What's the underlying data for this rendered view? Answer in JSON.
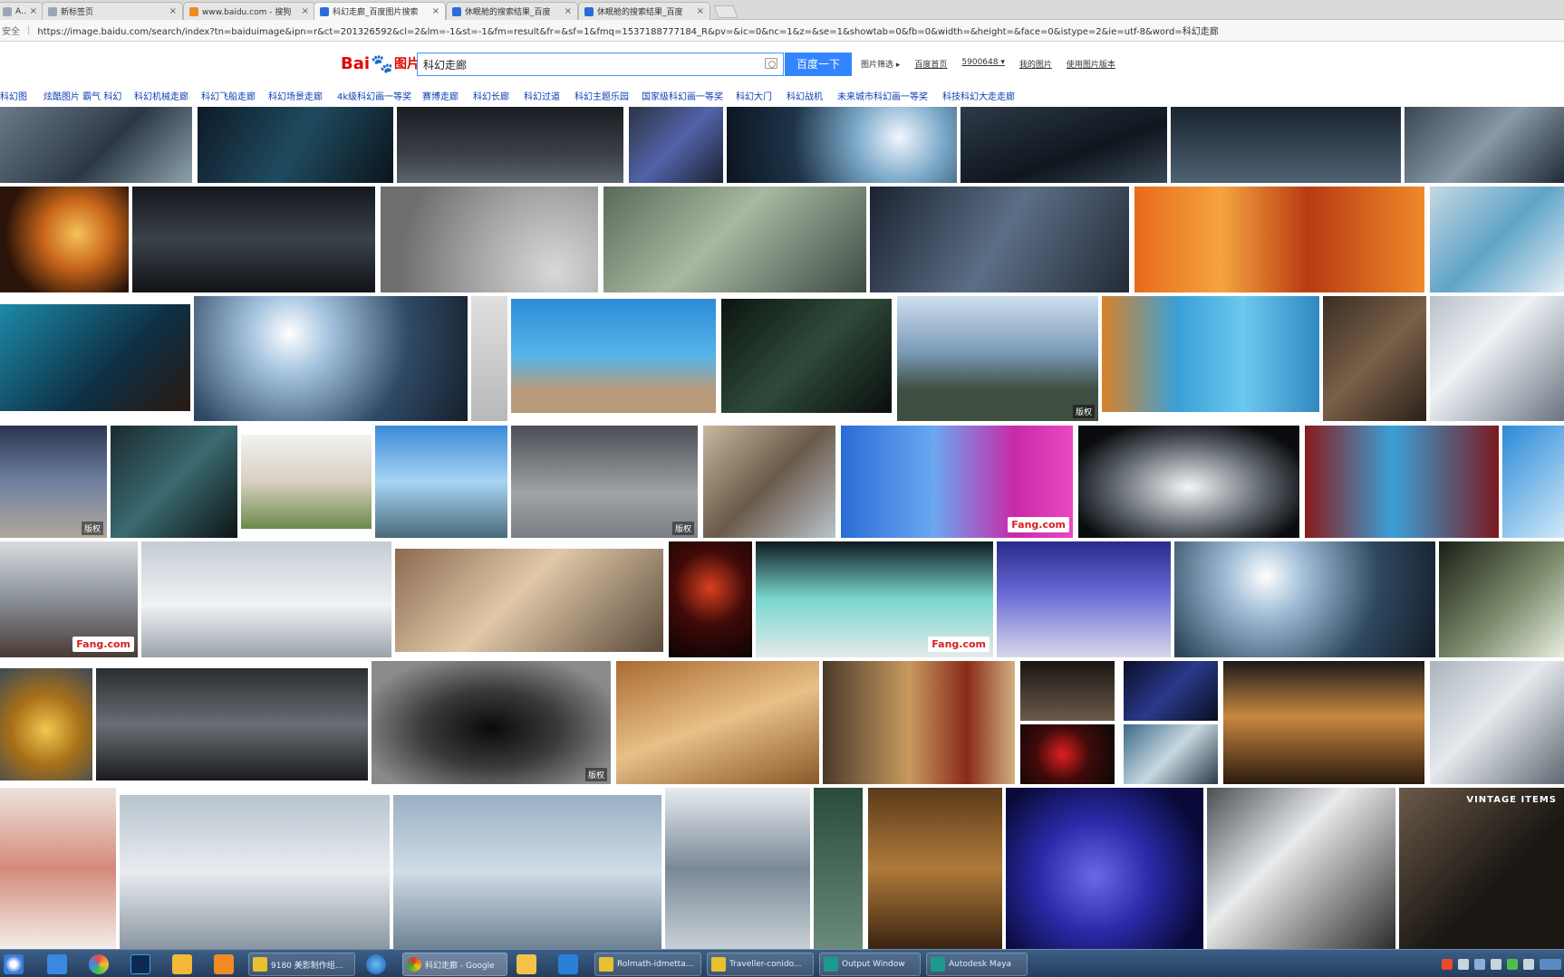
{
  "tabs": [
    {
      "label": "Ani",
      "icon": "document-icon",
      "color": "#9aa6b5"
    },
    {
      "label": "新标签页",
      "icon": "document-icon",
      "color": "#9aa6b5"
    },
    {
      "label": "www.baidu.com - 搜狗",
      "icon": "sogou-icon",
      "color": "#f08a24"
    },
    {
      "label": "科幻走廊_百度图片搜索",
      "icon": "paw-icon",
      "color": "#2b6cd9"
    },
    {
      "label": "休眠舱的搜索结果_百度",
      "icon": "paw-icon",
      "color": "#2b6cd9"
    },
    {
      "label": "休眠舱的搜索结果_百度",
      "icon": "paw-icon",
      "color": "#2b6cd9"
    }
  ],
  "address": {
    "secure_label": "安全",
    "url": "https://image.baidu.com/search/index?tn=baiduimage&ipn=r&ct=201326592&cl=2&lm=-1&st=-1&fm=result&fr=&sf=1&fmq=1537188777184_R&pv=&ic=0&nc=1&z=&se=1&showtab=0&fb=0&width=&height=&face=0&istype=2&ie=utf-8&word=科幻走廊"
  },
  "header": {
    "logo_bai": "Bai",
    "logo_paw": "du",
    "logo_pic": "图片",
    "query": "科幻走廊",
    "search_button": "百度一下",
    "links": [
      "图片筛选 ▸",
      "百度首页",
      "5900648 ▾",
      "我的图片",
      "使用图片版本"
    ]
  },
  "related": [
    "科幻图",
    "炫酷图片 霸气 科幻",
    "科幻机械走廊",
    "科幻飞船走廊",
    "科幻场景走廊",
    "4k级科幻画一等奖",
    "赛博走廊",
    "科幻长廊",
    "科幻过道",
    "科幻主题乐园",
    "国家级科幻画一等奖",
    "科幻大门",
    "科幻战机",
    "未来城市科幻画一等奖",
    "科技科幻大走走廊"
  ],
  "grid": {
    "watermark": "版权",
    "fang": "Fang.com",
    "vintage": "VINTAGE ITEMS"
  },
  "taskbar": {
    "items": [
      {
        "label": "360浏览器",
        "color": "#2f7bd6"
      },
      {
        "label": "Adobe Photoshop",
        "color": "#1b3d6e"
      },
      {
        "label": "Google Chrome",
        "color": "#e2b436"
      },
      {
        "label": "文件夹",
        "color": "#e8c25a"
      },
      {
        "label": "Output Window",
        "color": "#1c9a8c"
      },
      {
        "label": "Autodesk Maya",
        "color": "#1c9a8c"
      }
    ],
    "buttons": [
      "9180 美影制作组...",
      "科幻走廊 - Google",
      "Rolmath-idmetta...",
      "Traveller-conido...",
      "Output Window",
      "Autodesk Maya"
    ]
  }
}
